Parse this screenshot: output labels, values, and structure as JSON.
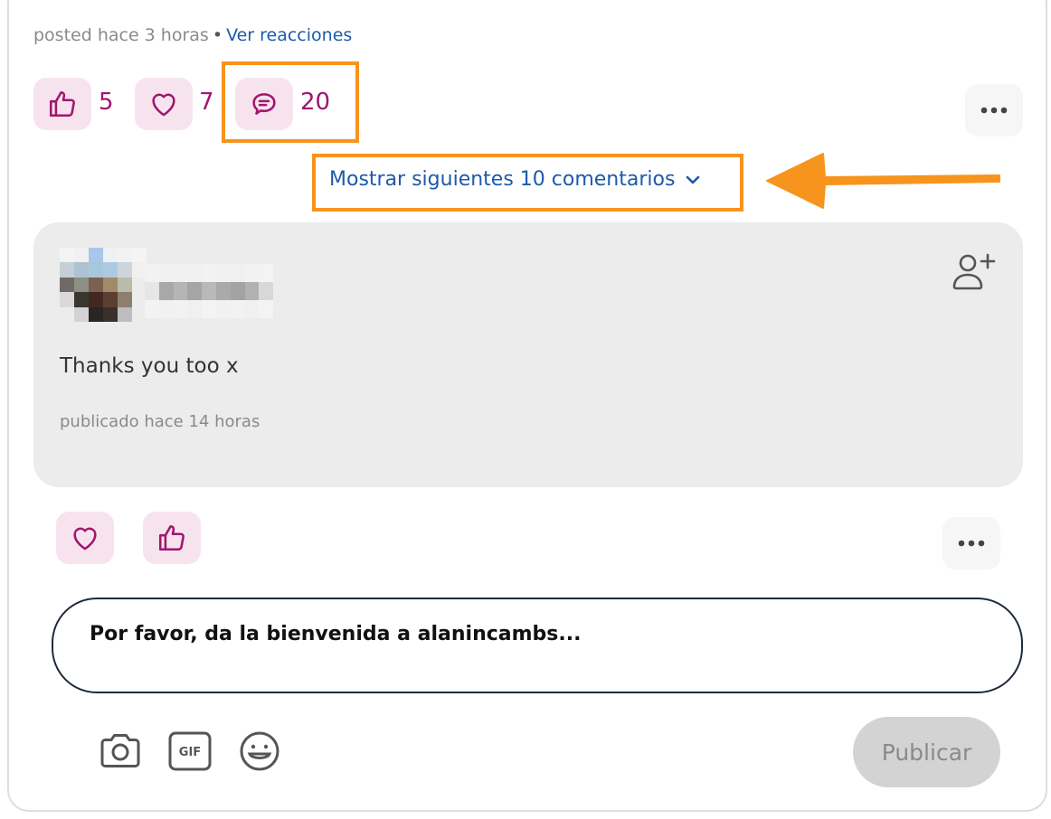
{
  "post": {
    "posted_prefix": "posted hace 3 horas",
    "separator": "•",
    "view_reactions": "Ver reacciones",
    "reactions": {
      "like_count": "5",
      "love_count": "7",
      "comment_count": "20"
    },
    "more_icon": "ellipsis-icon"
  },
  "comments": {
    "show_more_label": "Mostrar siguientes 10 comentarios",
    "items": [
      {
        "text": "Thanks you too x",
        "time": "publicado hace 14 horas"
      }
    ]
  },
  "composer": {
    "placeholder": "Por favor, da la bienvenida a alanincambs...",
    "publish_label": "Publicar",
    "tools": [
      "camera-icon",
      "gif-icon",
      "emoji-icon"
    ]
  },
  "colors": {
    "accent": "#a0166e",
    "reaction_bg": "#f7e3ee",
    "link": "#1e5aa8",
    "highlight": "#f7941d"
  }
}
